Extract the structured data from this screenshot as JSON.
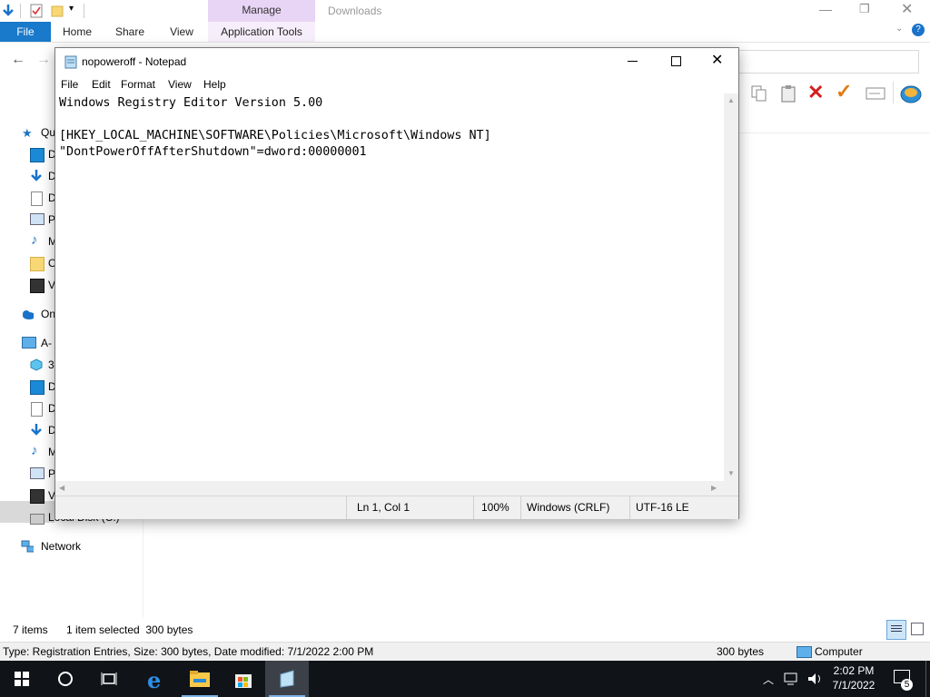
{
  "explorer": {
    "ribbon": {
      "manage_label": "Manage",
      "window_title": "Downloads",
      "tabs": [
        "File",
        "Home",
        "Share",
        "View",
        "Application Tools"
      ]
    },
    "nav": {
      "items": [
        {
          "label": "Qu",
          "icon": "star-icon"
        },
        {
          "label": "D",
          "icon": "desktop-icon"
        },
        {
          "label": "D",
          "icon": "downloads-icon"
        },
        {
          "label": "D",
          "icon": "documents-icon"
        },
        {
          "label": "P",
          "icon": "pictures-icon"
        },
        {
          "label": "M",
          "icon": "music-icon"
        },
        {
          "label": "O",
          "icon": "folder-icon"
        },
        {
          "label": "V",
          "icon": "videos-icon"
        },
        {
          "label": "On",
          "icon": "onedrive-icon"
        },
        {
          "label": "A-",
          "icon": "computer-icon"
        },
        {
          "label": "3",
          "icon": "3d-objects-icon"
        },
        {
          "label": "D",
          "icon": "desktop-icon"
        },
        {
          "label": "D",
          "icon": "documents-icon"
        },
        {
          "label": "D",
          "icon": "downloads-icon"
        },
        {
          "label": "M",
          "icon": "music-icon"
        },
        {
          "label": "P",
          "icon": "pictures-icon"
        },
        {
          "label": "V",
          "icon": "videos-icon"
        },
        {
          "label": "Local Disk (C:)",
          "icon": "drive-icon"
        },
        {
          "label": "Network",
          "icon": "network-icon"
        }
      ]
    },
    "status": {
      "items_count": "7 items",
      "selection": "1 item selected  300 bytes"
    },
    "details_bar": {
      "info": "Type: Registration Entries, Size: 300 bytes, Date modified: 7/1/2022 2:00 PM",
      "size": "300 bytes",
      "location": "Computer"
    }
  },
  "notepad": {
    "title": "nopoweroff - Notepad",
    "menu": [
      "File",
      "Edit",
      "Format",
      "View",
      "Help"
    ],
    "lines": [
      "Windows Registry Editor Version 5.00",
      "",
      "[HKEY_LOCAL_MACHINE\\SOFTWARE\\Policies\\Microsoft\\Windows NT]",
      "\"DontPowerOffAfterShutdown\"=dword:00000001"
    ],
    "status": {
      "position": "Ln 1, Col 1",
      "zoom": "100%",
      "line_ending": "Windows (CRLF)",
      "encoding": "UTF-16 LE"
    }
  },
  "taskbar": {
    "time": "2:02 PM",
    "date": "7/1/2022",
    "notification_count": "5"
  },
  "colors": {
    "accent": "#1979ca",
    "manage_tab": "#e8d4f5",
    "taskbar": "#101418"
  }
}
